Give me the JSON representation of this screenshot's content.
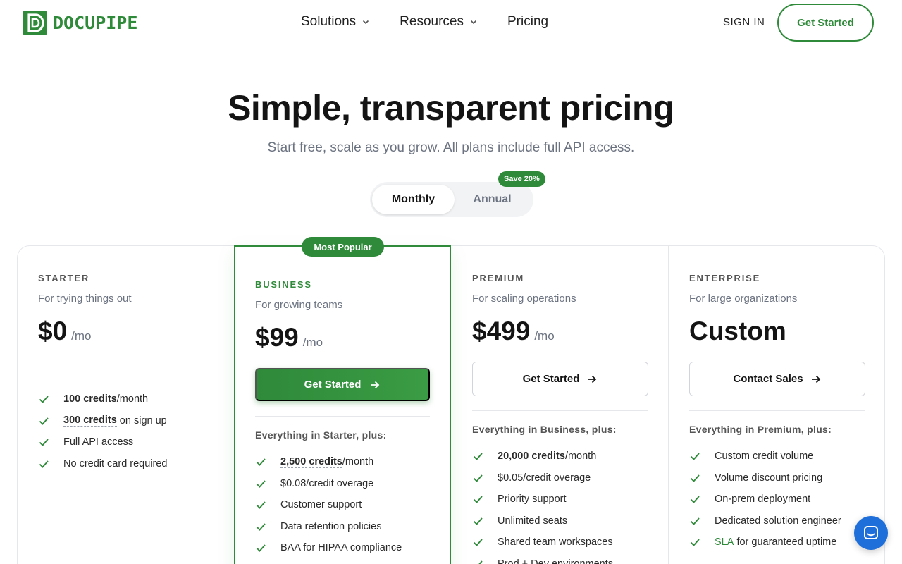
{
  "header": {
    "logo_text": "DOCUPIPE",
    "nav": [
      {
        "label": "Solutions",
        "icon": "chevron-down-icon"
      },
      {
        "label": "Resources",
        "icon": "chevron-down-icon"
      },
      {
        "label": "Pricing"
      }
    ],
    "sign_in": "SIGN IN",
    "cta": "Get Started"
  },
  "hero": {
    "title": "Simple, transparent pricing",
    "subtitle": "Start free, scale as you grow. All plans include full API access."
  },
  "billing_toggle": {
    "options": [
      "Monthly",
      "Annual"
    ],
    "selected": "Monthly",
    "badge": "Save 20%"
  },
  "plans": {
    "starter": {
      "tier": "STARTER",
      "description": "For trying things out",
      "price": "$0",
      "unit": "/mo",
      "features": [
        {
          "highlight": "100 credits",
          "text": "/month"
        },
        {
          "highlight": "300 credits",
          "text": " on sign up"
        },
        {
          "text": "Full API access"
        },
        {
          "text": "No credit card required"
        }
      ]
    },
    "business": {
      "badge": "Most Popular",
      "tier": "BUSINESS",
      "description": "For growing teams",
      "price": "$99",
      "unit": "/mo",
      "cta": "Get Started",
      "inherits": "Everything in Starter, plus:",
      "features": [
        {
          "highlight": "2,500 credits",
          "text": "/month"
        },
        {
          "text": "$0.08/credit overage"
        },
        {
          "text": "Customer support"
        },
        {
          "text": "Data retention policies"
        },
        {
          "text": "BAA for HIPAA compliance"
        }
      ]
    },
    "premium": {
      "tier": "PREMIUM",
      "description": "For scaling operations",
      "price": "$499",
      "unit": "/mo",
      "cta": "Get Started",
      "inherits": "Everything in Business, plus:",
      "features": [
        {
          "highlight": "20,000 credits",
          "text": "/month"
        },
        {
          "text": "$0.05/credit overage"
        },
        {
          "text": "Priority support"
        },
        {
          "text": "Unlimited seats"
        },
        {
          "text": "Shared team workspaces"
        },
        {
          "text": "Prod + Dev environments"
        }
      ]
    },
    "enterprise": {
      "tier": "ENTERPRISE",
      "description": "For large organizations",
      "price": "Custom",
      "cta": "Contact Sales",
      "inherits": "Everything in Premium, plus:",
      "features": [
        {
          "text": "Custom credit volume"
        },
        {
          "text": "Volume discount pricing"
        },
        {
          "text": "On-prem deployment"
        },
        {
          "text": "Dedicated solution engineer"
        },
        {
          "link": "SLA",
          "text": " for guaranteed uptime"
        }
      ]
    }
  },
  "colors": {
    "brand_green": "#2f8a3a",
    "chat_blue": "#1e6fd9"
  },
  "chat_widget": {
    "icon": "chat-bubble-icon"
  }
}
